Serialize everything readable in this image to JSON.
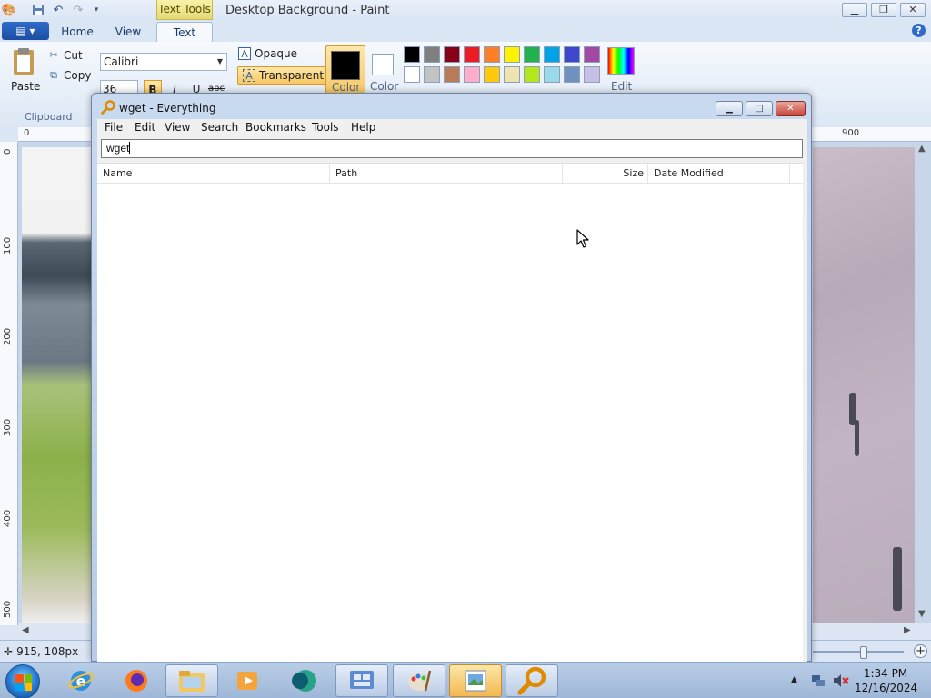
{
  "paint": {
    "title": "Desktop Background - Paint",
    "context_tab_group": "Text Tools",
    "tabs": [
      "Home",
      "View",
      "Text"
    ],
    "clipboard": {
      "paste": "Paste",
      "cut": "Cut",
      "copy": "Copy",
      "group_label": "Clipboard"
    },
    "font": {
      "family": "Calibri",
      "size": "36",
      "bold": "B",
      "italic": "I",
      "underline": "U",
      "strikethrough": "abc"
    },
    "background": {
      "opaque": "Opaque",
      "transparent": "Transparent"
    },
    "colors": {
      "color1_label": "Color",
      "color2_label": "Color",
      "edit_label": "Edit",
      "color1": "#000000",
      "color2": "#ffffff",
      "palette_row1": [
        "#000000",
        "#7f7f7f",
        "#880015",
        "#ed1c24",
        "#ff7f27",
        "#fff200",
        "#22b14c",
        "#00a2e8",
        "#3f48cc",
        "#a349a4"
      ],
      "palette_row2": [
        "#ffffff",
        "#c3c3c3",
        "#b97a57",
        "#ffaec9",
        "#ffc90e",
        "#efe4b0",
        "#b5e61d",
        "#99d9ea",
        "#7092be",
        "#c8bfe7"
      ]
    },
    "ruler_top": [
      "0",
      "900"
    ],
    "ruler_left": [
      "0",
      "100",
      "200",
      "300",
      "400",
      "500"
    ],
    "status": {
      "cursor_position": "915, 108px"
    }
  },
  "everything": {
    "title": "wget - Everything",
    "menu": [
      "File",
      "Edit",
      "View",
      "Search",
      "Bookmarks",
      "Tools",
      "Help"
    ],
    "search_value": "wget",
    "columns": [
      "Name",
      "Path",
      "Size",
      "Date Modified"
    ],
    "results": []
  },
  "taskbar": {
    "time": "1:34 PM",
    "date": "12/16/2024"
  }
}
